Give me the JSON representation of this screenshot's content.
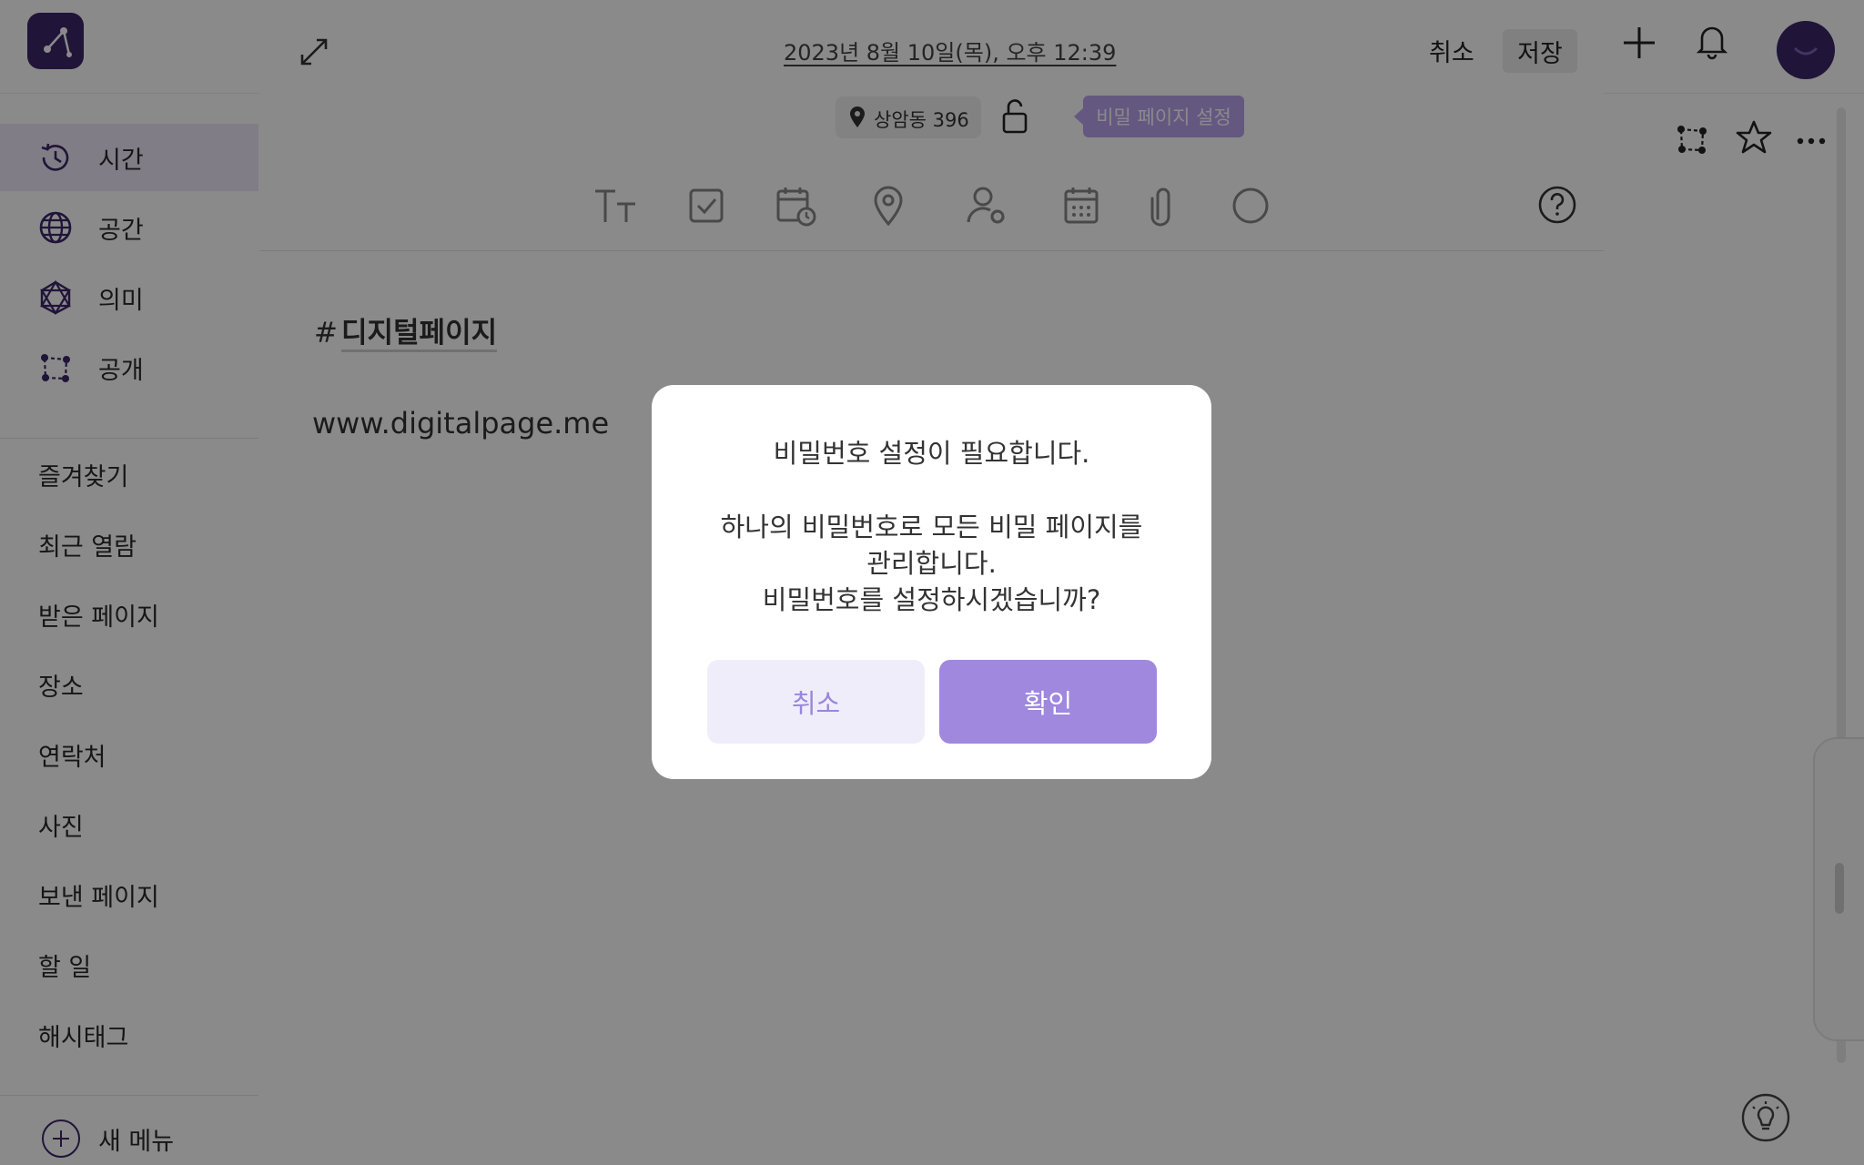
{
  "sidebar": {
    "nav": [
      {
        "label": "시간",
        "icon": "history-icon"
      },
      {
        "label": "공간",
        "icon": "globe-icon"
      },
      {
        "label": "의미",
        "icon": "network-icon"
      },
      {
        "label": "공개",
        "icon": "share-icon"
      }
    ],
    "links": [
      "즐겨찾기",
      "최근 열람",
      "받은 페이지",
      "장소",
      "연락처",
      "사진",
      "보낸 페이지",
      "할 일",
      "해시태그"
    ],
    "new_menu_label": "새 메뉴"
  },
  "editor": {
    "date": "2023년 8월 10일(목), 오후 12:39",
    "cancel_label": "취소",
    "save_label": "저장",
    "location": "상암동 396",
    "secret_tooltip": "비밀 페이지 설정",
    "toolbar_icons": [
      "text-size-icon",
      "checkbox-icon",
      "calendar-clock-icon",
      "location-pin-icon",
      "contact-icon",
      "calendar-icon",
      "paperclip-icon",
      "circle-icon",
      "help-icon"
    ],
    "hashtag_symbol": "#",
    "hashtag": "디지털페이지",
    "body_text": "www.digitalpage.me"
  },
  "dialog": {
    "title": "비밀번호 설정이 필요합니다.",
    "message_line1": "하나의 비밀번호로 모든 비밀 페이지를",
    "message_line2": "관리합니다.",
    "message_line3": "비밀번호를 설정하시겠습니까?",
    "cancel_label": "취소",
    "confirm_label": "확인"
  },
  "colors": {
    "brand": "#3b2569",
    "accent": "#9f88dd",
    "accent_light": "#f0edfb",
    "tooltip": "#b9a3ee"
  }
}
